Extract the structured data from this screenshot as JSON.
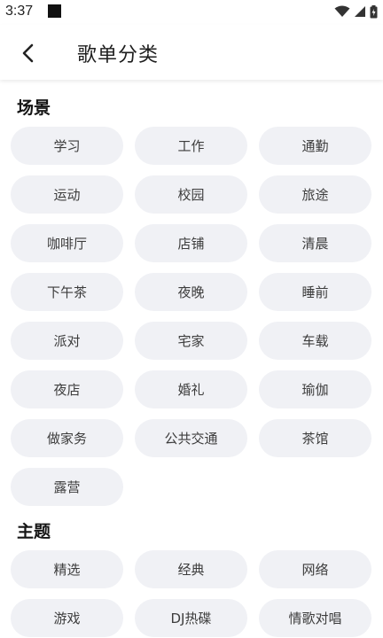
{
  "status": {
    "time": "3:37"
  },
  "header": {
    "title": "歌单分类"
  },
  "sections": [
    {
      "title": "场景",
      "items": [
        "学习",
        "工作",
        "通勤",
        "运动",
        "校园",
        "旅途",
        "咖啡厅",
        "店铺",
        "清晨",
        "下午茶",
        "夜晚",
        "睡前",
        "派对",
        "宅家",
        "车载",
        "夜店",
        "婚礼",
        "瑜伽",
        "做家务",
        "公共交通",
        "茶馆",
        "露营"
      ]
    },
    {
      "title": "主题",
      "items": [
        "精选",
        "经典",
        "网络",
        "游戏",
        "DJ热碟",
        "情歌对唱"
      ]
    }
  ]
}
